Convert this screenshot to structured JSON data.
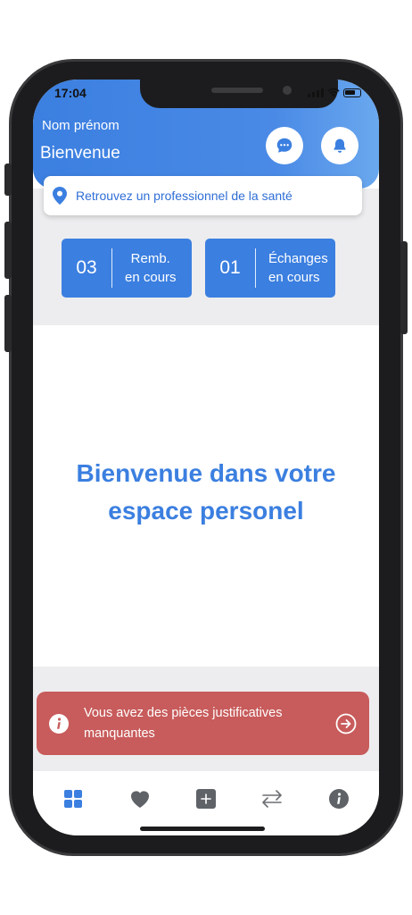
{
  "status_bar": {
    "time": "17:04"
  },
  "header": {
    "user_name": "Nom prénom",
    "greeting": "Bienvenue"
  },
  "search": {
    "text": "Retrouvez un professionnel de la santé"
  },
  "stats": [
    {
      "count": "03",
      "line1": "Remb.",
      "line2": "en cours"
    },
    {
      "count": "01",
      "line1": "Échanges",
      "line2": "en cours"
    }
  ],
  "welcome": {
    "line1": "Bienvenue dans votre",
    "line2": "espace personel"
  },
  "alert": {
    "line1": "Vous avez des pièces justificatives",
    "line2": "manquantes"
  },
  "tabs": [
    {
      "icon": "dashboard-icon"
    },
    {
      "icon": "heart-icon"
    },
    {
      "icon": "plus-square-icon"
    },
    {
      "icon": "exchange-arrows-icon"
    },
    {
      "icon": "info-icon"
    }
  ],
  "colors": {
    "primary": "#3b7fe0",
    "alert": "#c85b5b",
    "background_gray": "#ededef",
    "icon_gray": "#5f6368"
  }
}
